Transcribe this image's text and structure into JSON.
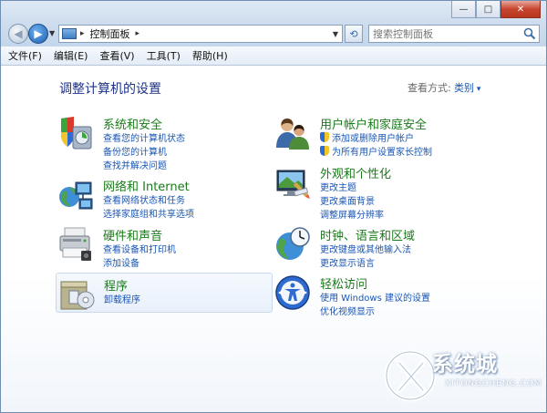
{
  "window": {
    "controls": [
      "—",
      "□",
      "✕"
    ]
  },
  "address": {
    "breadcrumb": "控制面板",
    "separator": "▸"
  },
  "search": {
    "placeholder": "搜索控制面板"
  },
  "menu": {
    "items": [
      "文件(F)",
      "编辑(E)",
      "查看(V)",
      "工具(T)",
      "帮助(H)"
    ]
  },
  "main": {
    "title": "调整计算机的设置",
    "view_by_label": "查看方式:",
    "view_by_value": "类别"
  },
  "categories": [
    {
      "title": "系统和安全",
      "icon": "system-security-icon",
      "links": [
        "查看您的计算机状态",
        "备份您的计算机",
        "查找并解决问题"
      ]
    },
    {
      "title": "用户帐户和家庭安全",
      "icon": "user-accounts-icon",
      "links": [
        "添加或删除用户帐户",
        "为所有用户设置家长控制"
      ],
      "shield_links": [
        true,
        true
      ]
    },
    {
      "title": "网络和 Internet",
      "icon": "network-internet-icon",
      "links": [
        "查看网络状态和任务",
        "选择家庭组和共享选项"
      ]
    },
    {
      "title": "外观和个性化",
      "icon": "appearance-icon",
      "links": [
        "更改主题",
        "更改桌面背景",
        "调整屏幕分辨率"
      ]
    },
    {
      "title": "硬件和声音",
      "icon": "hardware-sound-icon",
      "links": [
        "查看设备和打印机",
        "添加设备"
      ]
    },
    {
      "title": "时钟、语言和区域",
      "icon": "clock-language-region-icon",
      "links": [
        "更改键盘或其他输入法",
        "更改显示语言"
      ]
    },
    {
      "title": "程序",
      "icon": "programs-icon",
      "links": [
        "卸载程序"
      ]
    },
    {
      "title": "轻松访问",
      "icon": "ease-of-access-icon",
      "links": [
        "使用 Windows 建议的设置",
        "优化视频显示"
      ]
    }
  ],
  "watermark": {
    "text": "系统城",
    "sub": "XITONGCHENG.COM"
  },
  "colors": {
    "link": "#1a56b4",
    "category_title": "#1a7b1a",
    "page_title": "#1e3287"
  }
}
